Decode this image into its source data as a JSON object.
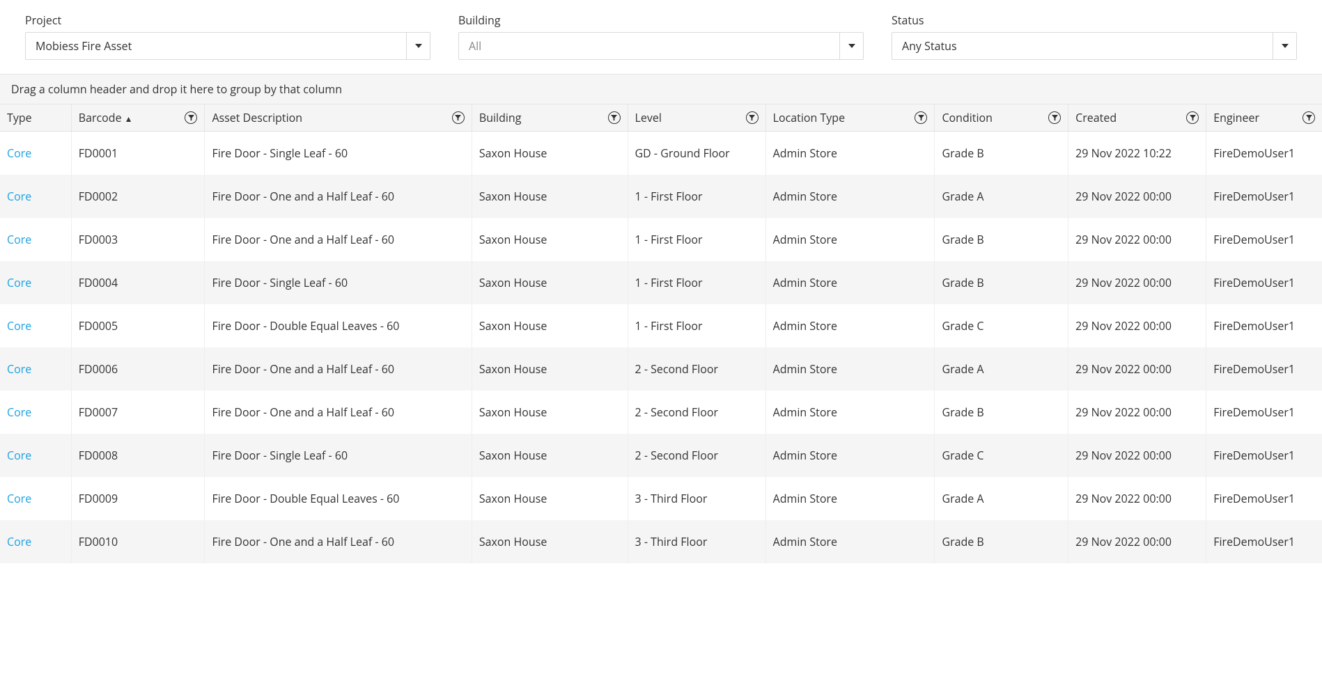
{
  "filters": {
    "project": {
      "label": "Project",
      "value": "Mobiess Fire Asset"
    },
    "building": {
      "label": "Building",
      "value": "All",
      "is_placeholder": true
    },
    "status": {
      "label": "Status",
      "value": "Any Status"
    }
  },
  "group_bar": "Drag a column header and drop it here to group by that column",
  "columns": [
    {
      "key": "type",
      "label": "Type",
      "filterable": false,
      "sorted": null,
      "cls": "col-type"
    },
    {
      "key": "barcode",
      "label": "Barcode",
      "filterable": true,
      "sorted": "asc",
      "cls": "col-barcode"
    },
    {
      "key": "description",
      "label": "Asset Description",
      "filterable": true,
      "sorted": null,
      "cls": "col-desc"
    },
    {
      "key": "building",
      "label": "Building",
      "filterable": true,
      "sorted": null,
      "cls": "col-building"
    },
    {
      "key": "level",
      "label": "Level",
      "filterable": true,
      "sorted": null,
      "cls": "col-level"
    },
    {
      "key": "location_type",
      "label": "Location Type",
      "filterable": true,
      "sorted": null,
      "cls": "col-loctype"
    },
    {
      "key": "condition",
      "label": "Condition",
      "filterable": true,
      "sorted": null,
      "cls": "col-condition"
    },
    {
      "key": "created",
      "label": "Created",
      "filterable": true,
      "sorted": null,
      "cls": "col-created"
    },
    {
      "key": "engineer",
      "label": "Engineer",
      "filterable": true,
      "sorted": null,
      "cls": "col-engineer"
    }
  ],
  "rows": [
    {
      "type": "Core",
      "barcode": "FD0001",
      "description": "Fire Door - Single Leaf - 60",
      "building": "Saxon House",
      "level": "GD - Ground Floor",
      "location_type": "Admin Store",
      "condition": "Grade B",
      "created": "29 Nov 2022 10:22",
      "engineer": "FireDemoUser1"
    },
    {
      "type": "Core",
      "barcode": "FD0002",
      "description": "Fire Door - One and a Half Leaf - 60",
      "building": "Saxon House",
      "level": "1 - First Floor",
      "location_type": "Admin Store",
      "condition": "Grade A",
      "created": "29 Nov 2022 00:00",
      "engineer": "FireDemoUser1"
    },
    {
      "type": "Core",
      "barcode": "FD0003",
      "description": "Fire Door - One and a Half Leaf - 60",
      "building": "Saxon House",
      "level": "1 - First Floor",
      "location_type": "Admin Store",
      "condition": "Grade B",
      "created": "29 Nov 2022 00:00",
      "engineer": "FireDemoUser1"
    },
    {
      "type": "Core",
      "barcode": "FD0004",
      "description": "Fire Door - Single Leaf - 60",
      "building": "Saxon House",
      "level": "1 - First Floor",
      "location_type": "Admin Store",
      "condition": "Grade B",
      "created": "29 Nov 2022 00:00",
      "engineer": "FireDemoUser1"
    },
    {
      "type": "Core",
      "barcode": "FD0005",
      "description": "Fire Door - Double Equal Leaves - 60",
      "building": "Saxon House",
      "level": "1 - First Floor",
      "location_type": "Admin Store",
      "condition": "Grade C",
      "created": "29 Nov 2022 00:00",
      "engineer": "FireDemoUser1"
    },
    {
      "type": "Core",
      "barcode": "FD0006",
      "description": "Fire Door - One and a Half Leaf - 60",
      "building": "Saxon House",
      "level": "2 - Second Floor",
      "location_type": "Admin Store",
      "condition": "Grade A",
      "created": "29 Nov 2022 00:00",
      "engineer": "FireDemoUser1"
    },
    {
      "type": "Core",
      "barcode": "FD0007",
      "description": "Fire Door - One and a Half Leaf - 60",
      "building": "Saxon House",
      "level": "2 - Second Floor",
      "location_type": "Admin Store",
      "condition": "Grade B",
      "created": "29 Nov 2022 00:00",
      "engineer": "FireDemoUser1"
    },
    {
      "type": "Core",
      "barcode": "FD0008",
      "description": "Fire Door - Single Leaf - 60",
      "building": "Saxon House",
      "level": "2 - Second Floor",
      "location_type": "Admin Store",
      "condition": "Grade C",
      "created": "29 Nov 2022 00:00",
      "engineer": "FireDemoUser1"
    },
    {
      "type": "Core",
      "barcode": "FD0009",
      "description": "Fire Door - Double Equal Leaves - 60",
      "building": "Saxon House",
      "level": "3 - Third Floor",
      "location_type": "Admin Store",
      "condition": "Grade A",
      "created": "29 Nov 2022 00:00",
      "engineer": "FireDemoUser1"
    },
    {
      "type": "Core",
      "barcode": "FD0010",
      "description": "Fire Door - One and a Half Leaf - 60",
      "building": "Saxon House",
      "level": "3 - Third Floor",
      "location_type": "Admin Store",
      "condition": "Grade B",
      "created": "29 Nov 2022 00:00",
      "engineer": "FireDemoUser1"
    }
  ]
}
